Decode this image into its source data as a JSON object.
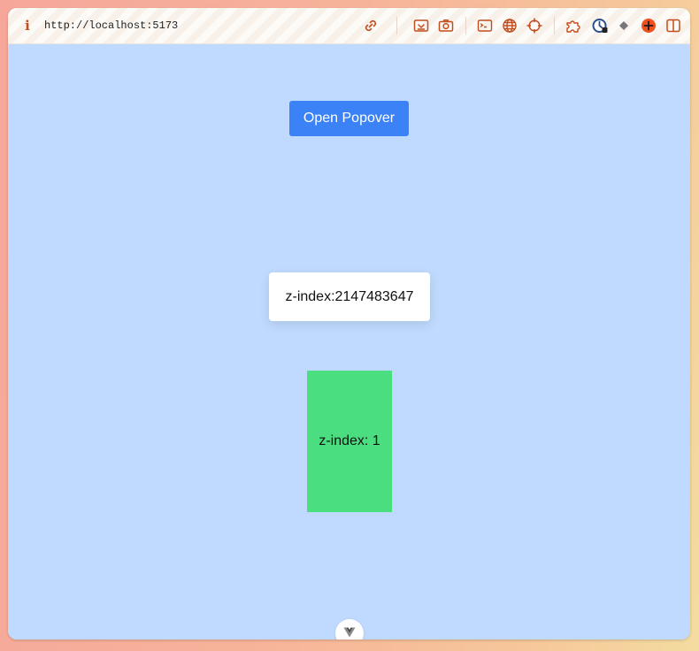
{
  "browser": {
    "url": "http://localhost:5173",
    "accent_color": "#c24d1e",
    "toolbar_icons": [
      "link-icon",
      "screenshot-region-icon",
      "camera-icon",
      "terminal-icon",
      "globe-icon",
      "crosshair-icon",
      "puzzle-icon",
      "timer-icon",
      "diamond-icon",
      "add-icon",
      "sidebar-icon"
    ]
  },
  "page": {
    "background_color": "#bfdafe",
    "open_button_label": "Open Popover",
    "open_button_color": "#3b82f6",
    "popover_text": "z-index:2147483647",
    "box_text": "z-index: 1",
    "box_color": "#4ade80",
    "devtools_icon": "vue-logo-icon"
  }
}
